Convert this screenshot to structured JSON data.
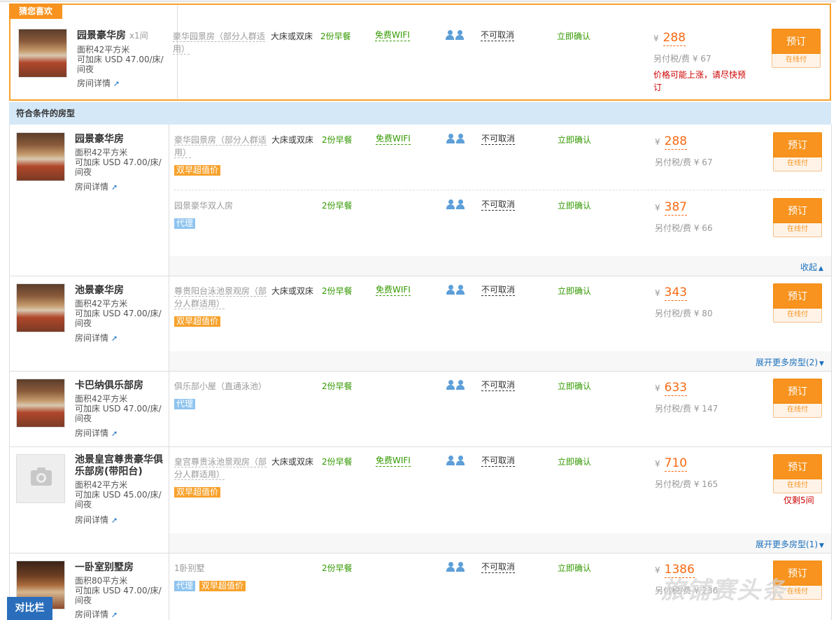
{
  "featured": {
    "badge": "猜您喜欢",
    "room_name": "园景豪华房",
    "room_qty": "x1间",
    "area": "面积42平方米",
    "extra_bed": "可加床 USD 47.00/床/",
    "extra_bed2": "间夜",
    "detail_link": "房间详情",
    "rate_name": "豪华园景房（部分人群适",
    "rate_name2": "用）",
    "bed": "大床或双床",
    "breakfast": "2份早餐",
    "wifi": "免费WIFI",
    "cancel": "不可取消",
    "confirm": "立即确认",
    "price": "288",
    "tax": "另付税/费 ¥ 67",
    "warn1": "价格可能上涨，请尽快预",
    "warn2": "订",
    "book": "预订",
    "pay": "在线付"
  },
  "section_title": "符合条件的房型",
  "currency": "¥",
  "rooms": [
    {
      "name": "园景豪华房",
      "area": "面积42平方米",
      "bed1": "可加床 USD 47.00/床/",
      "bed2": "间夜",
      "detail": "房间详情",
      "rates": [
        {
          "name1": "豪华园景房（部分人群适",
          "name2": "用）",
          "bed": "大床或双床",
          "breakfast": "2份早餐",
          "wifi": "免费WIFI",
          "cancel": "不可取消",
          "confirm": "立即确认",
          "price": "288",
          "tax": "另付税/费 ¥ 67",
          "tag": "双早超值价",
          "book": "预订",
          "pay": "在线付"
        },
        {
          "name1": "园景豪华双人房",
          "name2": "",
          "bed": "",
          "breakfast": "2份早餐",
          "wifi": "",
          "cancel": "不可取消",
          "confirm": "立即确认",
          "price": "387",
          "tax": "另付税/费 ¥ 66",
          "tag": "代理",
          "book": "预订",
          "pay": "在线付"
        }
      ],
      "footer": "收起"
    },
    {
      "name": "池景豪华房",
      "area": "面积42平方米",
      "bed1": "可加床 USD 47.00/床/",
      "bed2": "间夜",
      "detail": "房间详情",
      "rates": [
        {
          "name1": "尊贵阳台泳池景观房（部",
          "name2": "分人群适用）",
          "bed": "大床或双床",
          "breakfast": "2份早餐",
          "wifi": "免费WIFI",
          "cancel": "不可取消",
          "confirm": "立即确认",
          "price": "343",
          "tax": "另付税/费 ¥ 80",
          "tag": "双早超值价",
          "book": "预订",
          "pay": "在线付"
        }
      ],
      "footer": "展开更多房型(2)"
    },
    {
      "name": "卡巴纳俱乐部房",
      "area": "面积42平方米",
      "bed1": "可加床 USD 47.00/床/",
      "bed2": "间夜",
      "detail": "房间详情",
      "rates": [
        {
          "name1": "俱乐部小屋（直通泳池）",
          "name2": "",
          "bed": "",
          "breakfast": "2份早餐",
          "wifi": "",
          "cancel": "不可取消",
          "confirm": "立即确认",
          "price": "633",
          "tax": "另付税/费 ¥ 147",
          "tag": "代理",
          "book": "预订",
          "pay": "在线付"
        }
      ]
    },
    {
      "name1": "池景皇宫尊贵豪华俱",
      "name2": "乐部房(带阳台)",
      "area": "面积42平方米",
      "bed1": "可加床 USD 45.00/床/",
      "bed2": "间夜",
      "detail": "房间详情",
      "rates": [
        {
          "name1": "皇宫尊贵泳池景观房（部",
          "name2": "分人群适用）",
          "bed": "大床或双床",
          "breakfast": "2份早餐",
          "wifi": "免费WIFI",
          "cancel": "不可取消",
          "confirm": "立即确认",
          "price": "710",
          "tax": "另付税/费 ¥ 165",
          "tag": "双早超值价",
          "book": "预订",
          "pay": "在线付",
          "remaining": "仅剩5间"
        }
      ],
      "footer": "展开更多房型(1)"
    },
    {
      "name": "一卧室别墅房",
      "area": "面积80平方米",
      "bed1": "可加床 USD 47.00/床/",
      "bed2": "间夜",
      "detail": "房间详情",
      "rates": [
        {
          "name1": "1卧别墅",
          "name2": "",
          "bed": "",
          "breakfast": "2份早餐",
          "wifi": "",
          "cancel": "不可取消",
          "confirm": "立即确认",
          "price": "1386",
          "tax": "另付税/费 ¥ 236",
          "tag": "代理",
          "tag2": "双早超值价",
          "book": "预订",
          "pay": "在线付"
        }
      ]
    }
  ],
  "compare_bar": "对比栏",
  "watermark": "旅铺赛头条",
  "colors": {
    "orange": "#f7931e",
    "price": "#f76a13",
    "green": "#339900",
    "blue": "#1a6fbd",
    "section_bg": "#d4e8f8"
  }
}
